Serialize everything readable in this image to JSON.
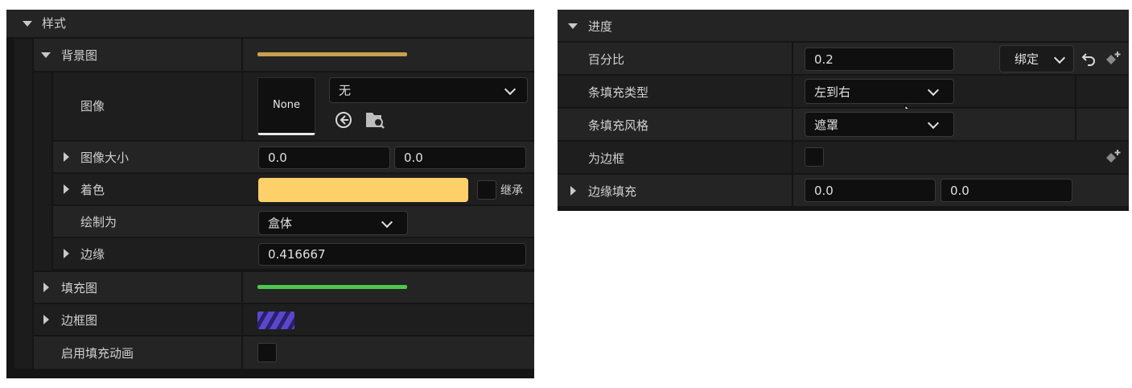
{
  "left_panel": {
    "section_title": "样式",
    "background_image": {
      "label": "背景图",
      "bar_color": "#c8a04e",
      "image": {
        "label": "图像",
        "thumb_text": "None",
        "dropdown_value": "无"
      },
      "image_size": {
        "label": "图像大小",
        "x": "0.0",
        "y": "0.0"
      },
      "tint": {
        "label": "着色",
        "color": "#fdd06a",
        "inherit_label": "继承"
      },
      "draw_as": {
        "label": "绘制为",
        "value": "盒体"
      },
      "margin": {
        "label": "边缘",
        "value": "0.416667"
      }
    },
    "fill_image": {
      "label": "填充图",
      "bar_color": "#4cc94c"
    },
    "border_image": {
      "label": "边框图",
      "swatch_color": "#4a3aa8"
    },
    "enable_fill_animation": {
      "label": "启用填充动画"
    }
  },
  "right_panel": {
    "section_title": "进度",
    "percent": {
      "label": "百分比",
      "value": "0.2",
      "bind_label": "绑定"
    },
    "bar_fill_type": {
      "label": "条填充类型",
      "value": "左到右"
    },
    "bar_fill_style": {
      "label": "条填充风格",
      "value": "遮罩"
    },
    "is_marquee": {
      "label": "为边框"
    },
    "border_padding": {
      "label": "边缘填充",
      "x": "0.0",
      "y": "0.0"
    }
  }
}
